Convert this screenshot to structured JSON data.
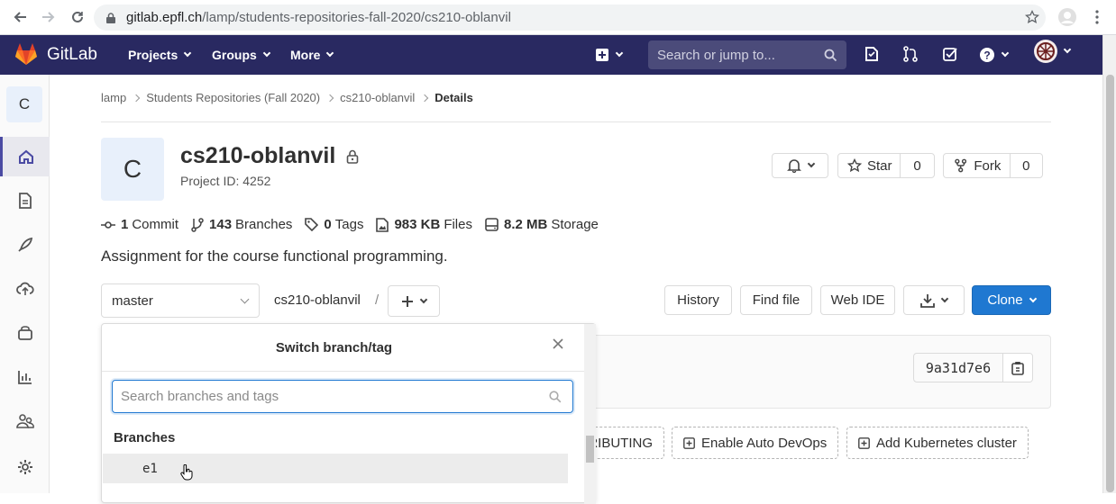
{
  "browser": {
    "url_host": "gitlab.epfl.ch",
    "url_path": "/lamp/students-repositories-fall-2020/cs210-oblanvil"
  },
  "topnav": {
    "logo_text": "GitLab",
    "menus": [
      "Projects",
      "Groups",
      "More"
    ],
    "search_placeholder": "Search or jump to..."
  },
  "sidebar": {
    "project_letter": "C"
  },
  "breadcrumb": {
    "items": [
      "lamp",
      "Students Repositories (Fall 2020)",
      "cs210-oblanvil"
    ],
    "current": "Details"
  },
  "project": {
    "avatar_letter": "C",
    "name": "cs210-oblanvil",
    "id_label": "Project ID: 4252",
    "description": "Assignment for the course functional programming."
  },
  "actions": {
    "star_label": "Star",
    "star_count": "0",
    "fork_label": "Fork",
    "fork_count": "0"
  },
  "stats": {
    "commits_value": "1",
    "commits_label": "Commit",
    "branches_value": "143",
    "branches_label": "Branches",
    "tags_value": "0",
    "tags_label": "Tags",
    "files_value": "983 KB",
    "files_label": "Files",
    "storage_value": "8.2 MB",
    "storage_label": "Storage"
  },
  "repo": {
    "branch": "master",
    "path": "cs210-oblanvil",
    "separator": "/",
    "history": "History",
    "find_file": "Find file",
    "web_ide": "Web IDE",
    "clone": "Clone",
    "commit_sha": "9a31d7e6"
  },
  "shortcuts": {
    "contributing": "RIBUTING",
    "auto_devops": "Enable Auto DevOps",
    "kubernetes": "Add Kubernetes cluster"
  },
  "dropdown": {
    "title": "Switch branch/tag",
    "search_placeholder": "Search branches and tags",
    "section": "Branches",
    "items": [
      "e1"
    ]
  },
  "colors": {
    "nav_bg": "#292961",
    "clone_bg": "#1f78d1"
  }
}
